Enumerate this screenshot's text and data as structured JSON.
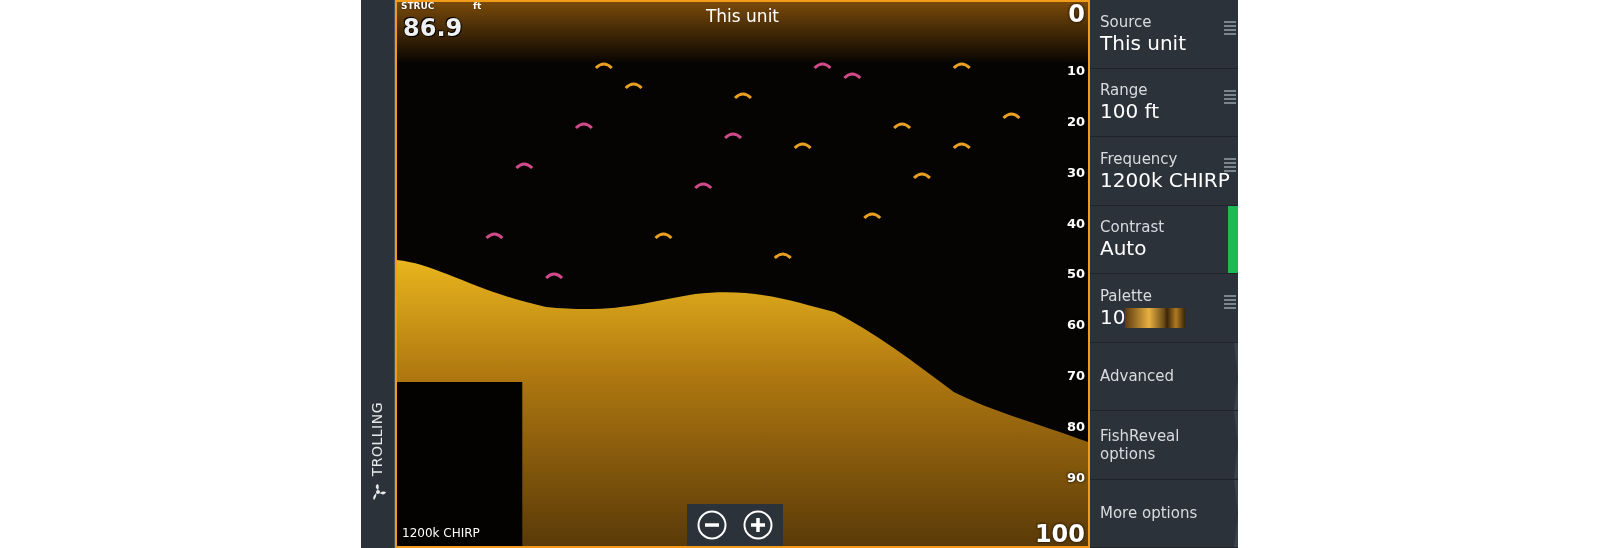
{
  "mode_bar": {
    "label": "TROLLING"
  },
  "sonar": {
    "source_title": "This unit",
    "depth_reading": {
      "label": "STRUC",
      "unit": "ft",
      "value": "86.9"
    },
    "depth_scale": [
      "0",
      "10",
      "20",
      "30",
      "40",
      "50",
      "60",
      "70",
      "80",
      "90",
      "100"
    ],
    "frequency_label": "1200k CHIRP",
    "zoom_buttons": [
      {
        "kind": "zoom-out"
      },
      {
        "kind": "zoom-in"
      }
    ]
  },
  "menu": [
    {
      "kind": "list",
      "label": "Source",
      "value": "This unit"
    },
    {
      "kind": "list",
      "label": "Range",
      "value": "100 ft"
    },
    {
      "kind": "list",
      "label": "Frequency",
      "value": "1200k CHIRP"
    },
    {
      "kind": "adjust",
      "label": "Contrast",
      "value": "Auto"
    },
    {
      "kind": "palette",
      "label": "Palette",
      "value": "10"
    },
    {
      "kind": "submenu",
      "label": "Advanced"
    },
    {
      "kind": "submenu",
      "label": "FishReveal options"
    },
    {
      "kind": "submenu",
      "label": "More options"
    }
  ]
}
